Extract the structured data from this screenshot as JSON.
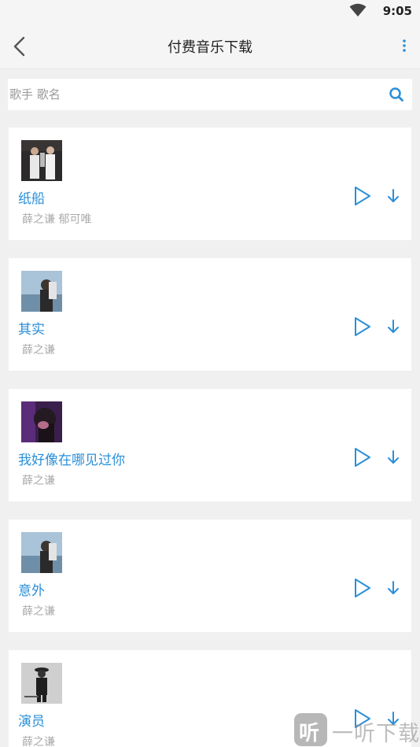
{
  "status": {
    "time": "9:05"
  },
  "header": {
    "title": "付费音乐下载"
  },
  "search": {
    "placeholder": "歌手 歌名"
  },
  "songs": [
    {
      "title": "纸船",
      "artist": "薛之谦 郁可唯"
    },
    {
      "title": "其实",
      "artist": "薛之谦"
    },
    {
      "title": "我好像在哪见过你",
      "artist": "薛之谦"
    },
    {
      "title": "意外",
      "artist": "薛之谦"
    },
    {
      "title": "演员",
      "artist": "薛之谦"
    }
  ],
  "watermark": {
    "logo_text": "听",
    "text": "一听下载"
  },
  "colors": {
    "accent": "#2b8fd8",
    "artist": "#aaaaaa",
    "background": "#f0f0f0"
  },
  "icons": [
    "wifi-icon",
    "back-icon",
    "more-vert-icon",
    "search-icon",
    "play-icon",
    "download-icon"
  ]
}
